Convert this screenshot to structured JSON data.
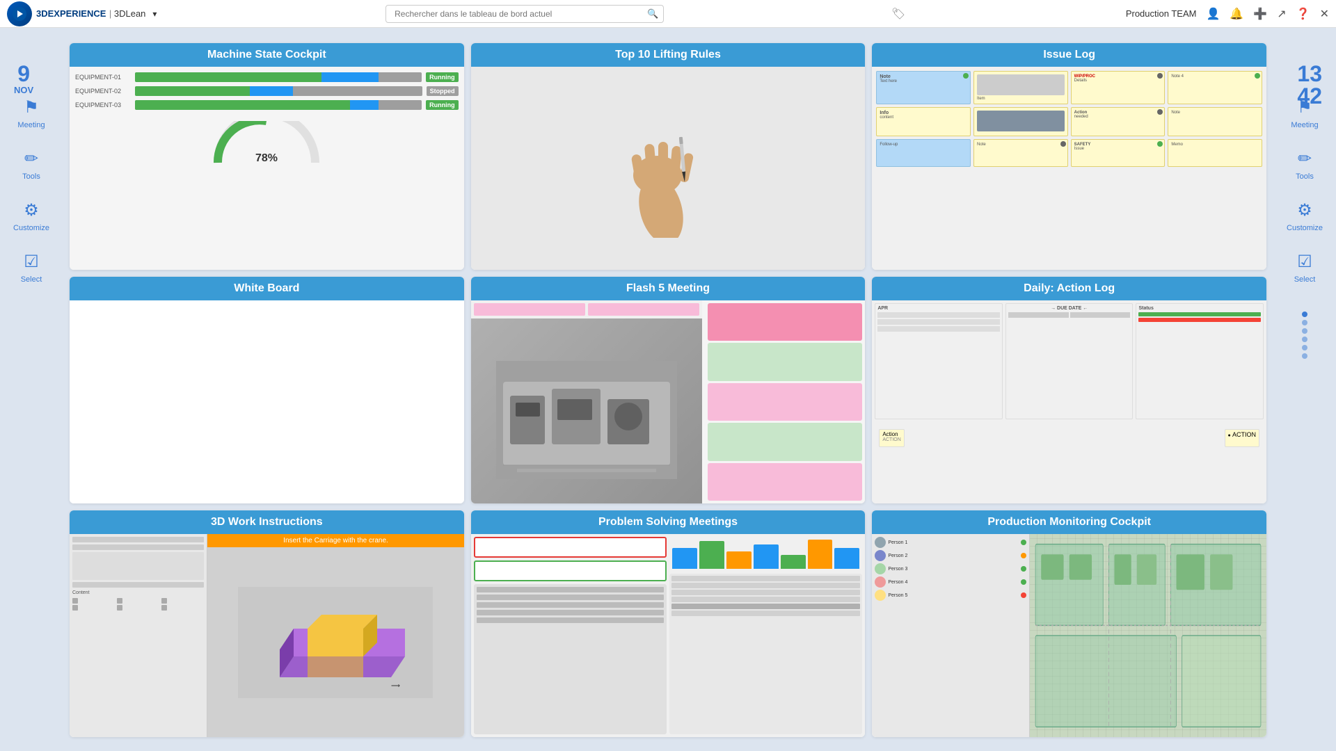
{
  "header": {
    "brand": "3DEXPERIENCE",
    "product": "3DLean",
    "search_placeholder": "Rechercher dans le tableau de bord actuel",
    "team_label": "Production TEAM"
  },
  "date": {
    "day": "9",
    "month": "NOV",
    "hour": "13",
    "minute": "42"
  },
  "sidebar": {
    "items": [
      {
        "label": "Meeting",
        "icon": "⚑"
      },
      {
        "label": "Tools",
        "icon": "✏"
      },
      {
        "label": "Customize",
        "icon": "⚙"
      },
      {
        "label": "Select",
        "icon": "☑"
      }
    ]
  },
  "tiles": [
    {
      "id": "machine-state-cockpit",
      "title": "Machine State Cockpit"
    },
    {
      "id": "top-10-lifting-rules",
      "title": "Top 10 Lifting Rules"
    },
    {
      "id": "issue-log",
      "title": "Issue Log"
    },
    {
      "id": "white-board",
      "title": "White Board"
    },
    {
      "id": "flash-5-meeting",
      "title": "Flash 5 Meeting"
    },
    {
      "id": "daily-action-log",
      "title": "Daily: Action Log"
    },
    {
      "id": "3d-work-instructions",
      "title": "3D Work Instructions"
    },
    {
      "id": "problem-solving-meetings",
      "title": "Problem Solving Meetings"
    },
    {
      "id": "production-monitoring-cockpit",
      "title": "Production Monitoring Cockpit"
    }
  ],
  "wi_banner_text": "Insert the Carriage with the crane.",
  "action_label_1": "Action",
  "action_label_2": "ACTION"
}
